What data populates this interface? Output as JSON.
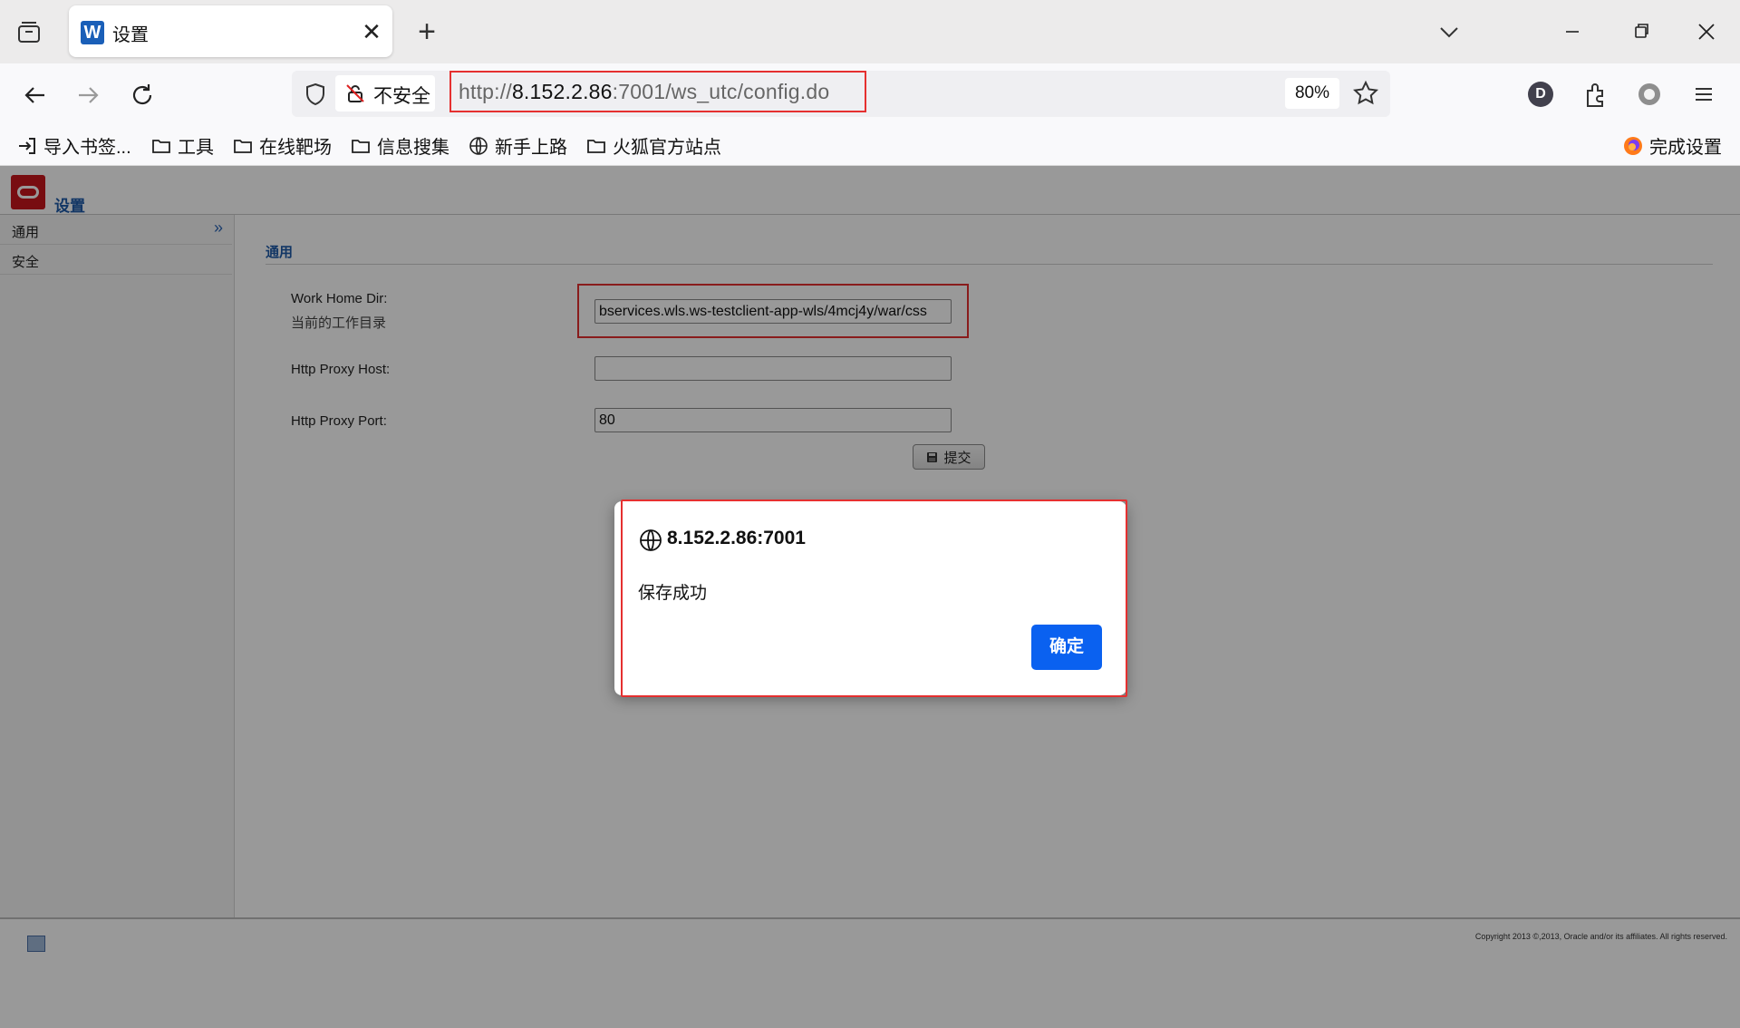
{
  "browser": {
    "tab": {
      "title": "设置",
      "favicon": "W"
    },
    "url": {
      "scheme": "http://",
      "host": "8.152.2.86",
      "rest": ":7001/ws_utc/config.do"
    },
    "security_label": "不安全",
    "zoom": "80%",
    "avatar_letter": "D",
    "bookmarks": [
      {
        "label": "导入书签...",
        "icon": "import-icon"
      },
      {
        "label": "工具",
        "icon": "folder-icon"
      },
      {
        "label": "在线靶场",
        "icon": "folder-icon"
      },
      {
        "label": "信息搜集",
        "icon": "folder-icon"
      },
      {
        "label": "新手上路",
        "icon": "globe-icon"
      },
      {
        "label": "火狐官方站点",
        "icon": "folder-icon"
      }
    ],
    "bookmark_right": "完成设置"
  },
  "app": {
    "title": "设置",
    "sidebar": [
      {
        "label": "通用"
      },
      {
        "label": "安全"
      }
    ],
    "section_title": "通用",
    "fields": {
      "work_home_dir": {
        "label": "Work Home Dir:",
        "sublabel": "当前的工作目录",
        "value": "bservices.wls.ws-testclient-app-wls/4mcj4y/war/css"
      },
      "proxy_host": {
        "label": "Http Proxy Host:",
        "value": ""
      },
      "proxy_port": {
        "label": "Http Proxy Port:",
        "value": "80"
      }
    },
    "submit_label": "提交",
    "copyright": "Copyright 2013 ©,2013, Oracle and/or its affiliates. All rights reserved."
  },
  "dialog": {
    "origin": "8.152.2.86:7001",
    "message": "保存成功",
    "ok_label": "确定"
  },
  "colors": {
    "accent": "#0a61f0",
    "highlight": "#e53030",
    "oracle_red": "#c8161d",
    "link_blue": "#1f5aa8"
  }
}
